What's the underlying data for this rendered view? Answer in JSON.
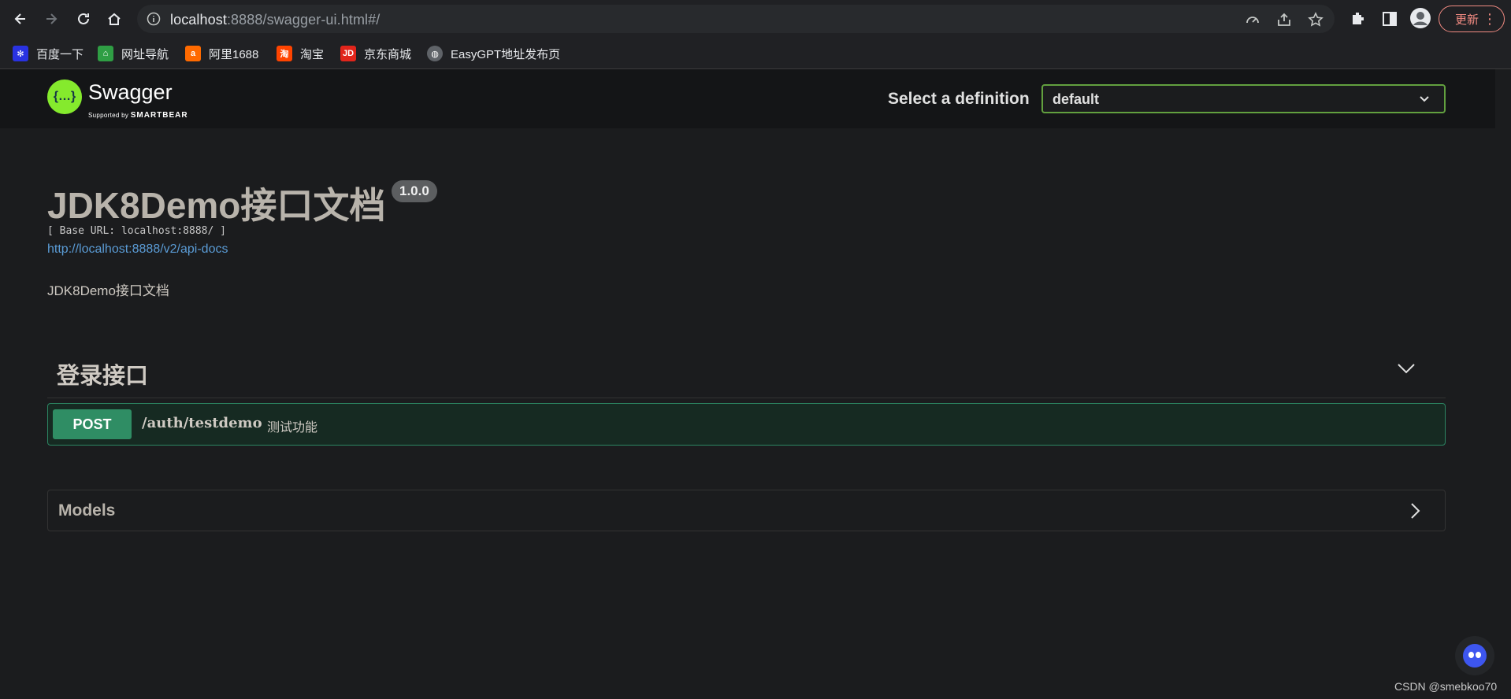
{
  "browser": {
    "url_host": "localhost",
    "url_rest": ":8888/swagger-ui.html#/",
    "update_label": "更新"
  },
  "bookmarks": [
    {
      "label": "百度一下",
      "icon": "baidu-icon"
    },
    {
      "label": "网址导航",
      "icon": "house-icon"
    },
    {
      "label": "阿里1688",
      "icon": "alibaba-icon"
    },
    {
      "label": "淘宝",
      "icon": "taobao-icon"
    },
    {
      "label": "京东商城",
      "icon": "jd-icon"
    },
    {
      "label": "EasyGPT地址发布页",
      "icon": "globe-icon"
    }
  ],
  "swagger": {
    "logo_glyph": "{…}",
    "brand": "Swagger",
    "supported_by": "Supported by",
    "smartbear": "SMARTBEAR",
    "definition_label": "Select a definition",
    "definition_value": "default"
  },
  "info": {
    "title": "JDK8Demo接口文档",
    "version": "1.0.0",
    "base_url": "[ Base URL: localhost:8888/ ]",
    "docs_link": "http://localhost:8888/v2/api-docs",
    "description": "JDK8Demo接口文档"
  },
  "tag": {
    "name": "登录接口",
    "operation": {
      "method": "POST",
      "path": "/auth/testdemo",
      "summary": "测试功能"
    }
  },
  "models": {
    "title": "Models"
  },
  "watermark": "CSDN @smebkoo70",
  "colors": {
    "post_green": "#2f8d64",
    "swagger_green": "#85ea2d",
    "link_blue": "#5a9bd5"
  }
}
